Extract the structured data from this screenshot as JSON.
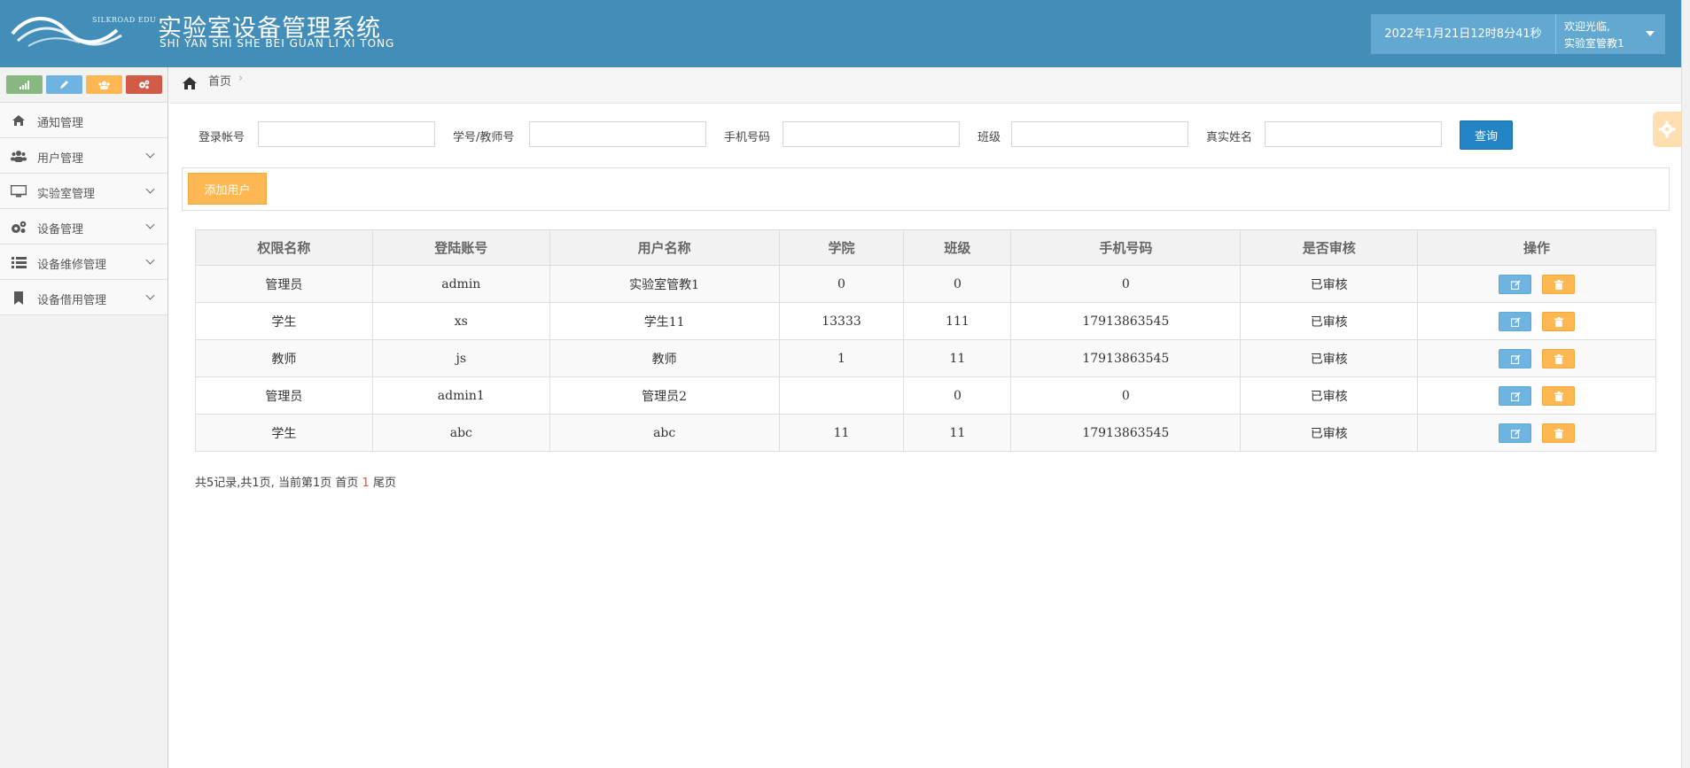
{
  "header": {
    "logo_text": "SILKROAD EDU",
    "title_cn": "实验室设备管理系统",
    "title_en": "SHI YAN SHI SHE BEI GUAN LI XI TONG",
    "datetime": "2022年1月21日12时8分41秒",
    "welcome_line1": "欢迎光临,",
    "welcome_line2": "实验室管教1"
  },
  "shortcuts": [
    {
      "icon": "signal-icon",
      "color": "#87b87f"
    },
    {
      "icon": "pencil-icon",
      "color": "#6fb3e0"
    },
    {
      "icon": "group-icon",
      "color": "#ffb752"
    },
    {
      "icon": "cogs-icon",
      "color": "#d15b47"
    }
  ],
  "sidebar": {
    "items": [
      {
        "label": "通知管理",
        "icon": "home-icon",
        "has_submenu": false
      },
      {
        "label": "用户管理",
        "icon": "users-icon",
        "has_submenu": true
      },
      {
        "label": "实验室管理",
        "icon": "desktop-icon",
        "has_submenu": true
      },
      {
        "label": "设备管理",
        "icon": "cogs-icon",
        "has_submenu": true
      },
      {
        "label": "设备维修管理",
        "icon": "list-icon",
        "has_submenu": true
      },
      {
        "label": "设备借用管理",
        "icon": "bookmark-icon",
        "has_submenu": true
      }
    ]
  },
  "breadcrumb": {
    "home": "首页"
  },
  "search": {
    "login_label": "登录帐号",
    "login_value": "",
    "studentno_label": "学号/教师号",
    "studentno_value": "",
    "phone_label": "手机号码",
    "phone_value": "",
    "class_label": "班级",
    "class_value": "",
    "realname_label": "真实姓名",
    "realname_value": "",
    "query_label": "查询"
  },
  "toolbar": {
    "add_label": "添加用户"
  },
  "table": {
    "headers": [
      "权限名称",
      "登陆账号",
      "用户名称",
      "学院",
      "班级",
      "手机号码",
      "是否审核",
      "操作"
    ],
    "rows": [
      [
        "管理员",
        "admin",
        "实验室管教1",
        "0",
        "0",
        "0",
        "已审核"
      ],
      [
        "学生",
        "xs",
        "学生11",
        "13333",
        "111",
        "17913863545",
        "已审核"
      ],
      [
        "教师",
        "js",
        "教师",
        "1",
        "11",
        "17913863545",
        "已审核"
      ],
      [
        "管理员",
        "admin1",
        "管理员2",
        "",
        "0",
        "0",
        "已审核"
      ],
      [
        "学生",
        "abc",
        "abc",
        "11",
        "11",
        "17913863545",
        "已审核"
      ]
    ]
  },
  "pager": {
    "summary": "共5记录,共1页, 当前第1页",
    "first": "首页",
    "current": "1",
    "last": "尾页"
  }
}
